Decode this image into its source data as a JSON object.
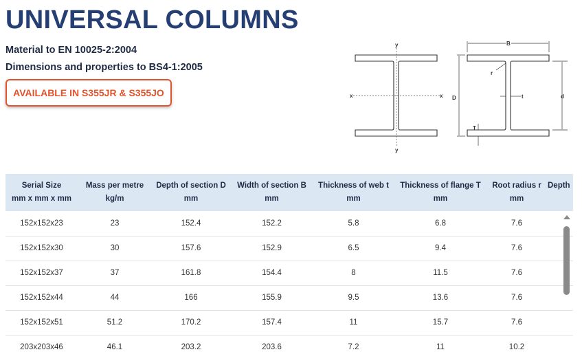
{
  "page": {
    "title": "UNIVERSAL COLUMNS",
    "material": "Material to EN 10025-2:2004",
    "dimensions": "Dimensions and properties to BS4-1:2005",
    "badge": "AVAILABLE IN S355JR & S355JO"
  },
  "diagram": {
    "labels": {
      "y": "y",
      "x": "x",
      "B": "B",
      "D": "D",
      "d": "d",
      "r": "r",
      "t": "t",
      "T": "T"
    }
  },
  "table": {
    "headers": [
      {
        "title": "Serial Size",
        "unit": "mm x mm x mm"
      },
      {
        "title": "Mass per metre",
        "unit": "kg/m"
      },
      {
        "title": "Depth of section D",
        "unit": "mm"
      },
      {
        "title": "Width of section B",
        "unit": "mm"
      },
      {
        "title": "Thickness of web t",
        "unit": "mm"
      },
      {
        "title": "Thickness of flange T",
        "unit": "mm"
      },
      {
        "title": "Root radius r",
        "unit": "mm"
      },
      {
        "title": "Depth",
        "unit": ""
      }
    ],
    "rows": [
      [
        "152x152x23",
        "23",
        "152.4",
        "152.2",
        "5.8",
        "6.8",
        "7.6",
        ""
      ],
      [
        "152x152x30",
        "30",
        "157.6",
        "152.9",
        "6.5",
        "9.4",
        "7.6",
        ""
      ],
      [
        "152x152x37",
        "37",
        "161.8",
        "154.4",
        "8",
        "11.5",
        "7.6",
        ""
      ],
      [
        "152x152x44",
        "44",
        "166",
        "155.9",
        "9.5",
        "13.6",
        "7.6",
        ""
      ],
      [
        "152x152x51",
        "51.2",
        "170.2",
        "157.4",
        "11",
        "15.7",
        "7.6",
        ""
      ],
      [
        "203x203x46",
        "46.1",
        "203.2",
        "203.6",
        "7.2",
        "11",
        "10.2",
        ""
      ]
    ]
  }
}
